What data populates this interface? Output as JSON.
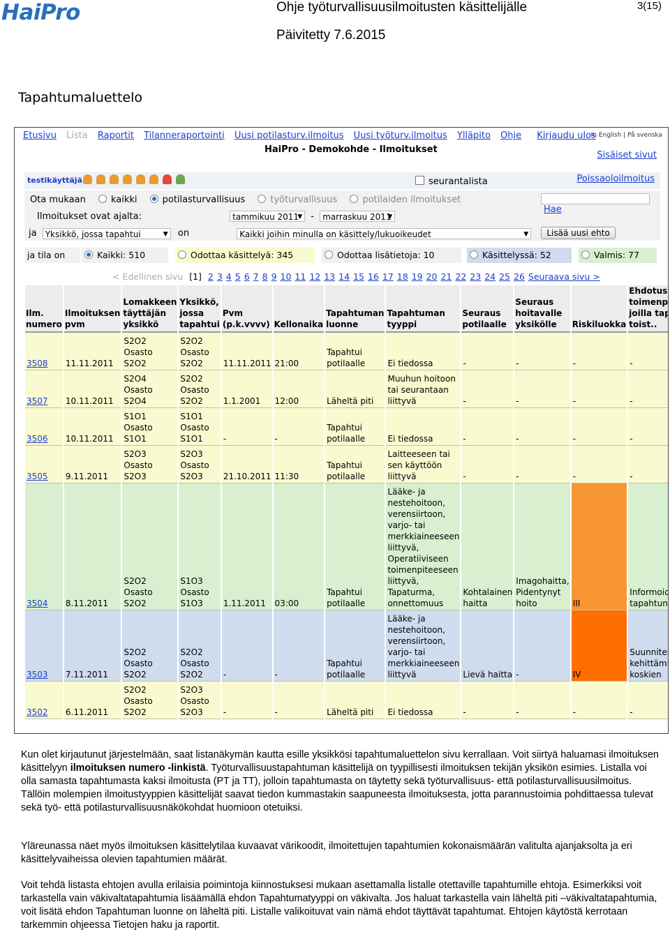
{
  "doc": {
    "logo": "HaiPro",
    "title": "Ohje työturvallisuusilmoitusten käsittelijälle",
    "updated": "Päivitetty 7.6.2015",
    "page": "3(15)",
    "section_heading": "Tapahtumaluettelo"
  },
  "app": {
    "nav": [
      "Etusivu",
      "Lista",
      "Raportit",
      "Tilanneraportointi",
      "Uusi potilasturv.ilmoitus",
      "Uusi työturv.ilmoitus",
      "Ylläpito",
      "Ohje",
      "Kirjaudu ulos"
    ],
    "nav_disabled": "Lista",
    "lang_links": "In English | På svenska",
    "title": "HaiPro - Demokohde - Ilmoitukset",
    "intranet_link": "Sisäiset sivut",
    "username": "testikäyttäjä",
    "follow_label": "seurantalista",
    "absence_link": "Poissaoloilmoitus",
    "filters": {
      "take_label": "Ota mukaan",
      "type_options": [
        "kaikki",
        "potilasturvallisuus",
        "työturvallisuus",
        "potilaiden ilmoitukset"
      ],
      "type_selected": "potilasturvallisuus",
      "period_label": "Ilmoitukset ovat ajalta:",
      "from": "tammikuu 2011",
      "dash": "-",
      "to": "marraskuu 2011",
      "and_label": "ja",
      "unit_select": "Yksikkö, jossa tapahtui",
      "on_label": "on",
      "scope_select": "Kaikki joihin minulla on käsittely/lukuoikeudet",
      "add_condition": "Lisää uusi ehto",
      "search_value": "",
      "search_link": "Hae"
    },
    "status": {
      "label": "ja tila on",
      "items": [
        {
          "text": "Kaikki: 510",
          "color": "#f0f0f0",
          "selected": true
        },
        {
          "text": "Odottaa käsittelyä: 345",
          "color": "#fafad0",
          "selected": false
        },
        {
          "text": "Odottaa lisätietoja: 10",
          "color": "#f0f0f0",
          "selected": false
        },
        {
          "text": "Käsittelyssä: 52",
          "color": "#cfdcee",
          "selected": false
        },
        {
          "text": "Valmis: 77",
          "color": "#d8f0d0",
          "selected": false
        }
      ]
    },
    "pager": {
      "prev": "< Edellinen sivu",
      "current": "[1]",
      "pages": [
        "2",
        "3",
        "4",
        "5",
        "6",
        "7",
        "8",
        "9",
        "10",
        "11",
        "12",
        "13",
        "14",
        "15",
        "16",
        "17",
        "18",
        "19",
        "20",
        "21",
        "22",
        "23",
        "24",
        "25",
        "26"
      ],
      "next": "Seuraava sivu >"
    },
    "table": {
      "headers": [
        "Ilm. numero",
        "Ilmoituksen pvm",
        "Lomakkeen täyttäjän yksikkö",
        "Yksikkö, jossa tapahtui",
        "Pvm (p.k.vvvv)",
        "Kellonaika",
        "Tapahtuman luonne",
        "Tapahtuman tyyppi",
        "Seuraus potilaalle",
        "Seuraus hoitavalle yksikölle",
        "Riskiluokka",
        "Ehdotus toimenpiteiksi, joilla tapahtuman toist.."
      ],
      "rows": [
        {
          "state": "y",
          "num": "3508",
          "date": "11.11.2011",
          "filler": "S2O2 Osasto S2O2",
          "unit": "S2O2 Osasto S2O2",
          "pvm": "11.11.2011",
          "time": "21:00",
          "nature": "Tapahtui potilaalle",
          "type": "Ei tiedossa",
          "patient": "-",
          "unit_cons": "-",
          "risk": "-",
          "risk_class": "",
          "proposal": "-"
        },
        {
          "state": "y",
          "num": "3507",
          "date": "10.11.2011",
          "filler": "S2O4 Osasto S2O4",
          "unit": "S2O2 Osasto S2O2",
          "pvm": "1.1.2001",
          "time": "12:00",
          "nature": "Läheltä piti",
          "type": "Muuhun hoitoon tai seurantaan liittyvä",
          "patient": "-",
          "unit_cons": "-",
          "risk": "-",
          "risk_class": "",
          "proposal": "-"
        },
        {
          "state": "y",
          "num": "3506",
          "date": "10.11.2011",
          "filler": "S1O1 Osasto S1O1",
          "unit": "S1O1 Osasto S1O1",
          "pvm": "-",
          "time": "-",
          "nature": "Tapahtui potilaalle",
          "type": "Ei tiedossa",
          "patient": "-",
          "unit_cons": "-",
          "risk": "-",
          "risk_class": "",
          "proposal": "-"
        },
        {
          "state": "y",
          "num": "3505",
          "date": "9.11.2011",
          "filler": "S2O3 Osasto S2O3",
          "unit": "S2O3 Osasto S2O3",
          "pvm": "21.10.2011",
          "time": "11:30",
          "nature": "Tapahtui potilaalle",
          "type": "Laitteeseen tai sen käyttöön liittyvä",
          "patient": "-",
          "unit_cons": "-",
          "risk": "-",
          "risk_class": "",
          "proposal": "-"
        },
        {
          "state": "g",
          "num": "3504",
          "date": "8.11.2011",
          "filler": "S2O2 Osasto S2O2",
          "unit": "S1O3 Osasto S1O3",
          "pvm": "1.11.2011",
          "time": "03:00",
          "nature": "Tapahtui potilaalle",
          "type": "Lääke- ja nestehoitoon, verensiirtoon, varjo- tai merkkiaineeseen liittyvä, Operatiiviseen toimenpiteeseen liittyvä, Tapaturma, onnettomuus",
          "patient": "Kohtalainen haitta",
          "unit_cons": "Imagohaitta, Pidentynyt hoito",
          "risk": "III",
          "risk_class": "risk3",
          "proposal": "Informoidaan tapahtuneesta"
        },
        {
          "state": "b",
          "num": "3503",
          "date": "7.11.2011",
          "filler": "S2O2 Osasto S2O2",
          "unit": "S2O2 Osasto S2O2",
          "pvm": "-",
          "time": "-",
          "nature": "Tapahtui potilaalle",
          "type": "Lääke- ja nestehoitoon, verensiirtoon, varjo- tai merkkiaineeseen liittyvä",
          "patient": "Lievä haitta",
          "unit_cons": "-",
          "risk": "IV",
          "risk_class": "risk4",
          "proposal": "Suunnitellaan kehittämistoimenpide koskien"
        },
        {
          "state": "y",
          "num": "3502",
          "date": "6.11.2011",
          "filler": "S2O2 Osasto S2O2",
          "unit": "S2O3 Osasto S2O3",
          "pvm": "-",
          "time": "-",
          "nature": "Läheltä piti",
          "type": "Ei tiedossa",
          "patient": "-",
          "unit_cons": "-",
          "risk": "-",
          "risk_class": "",
          "proposal": "-"
        }
      ]
    }
  },
  "body_text": {
    "p1_a": "Kun olet kirjautunut järjestelmään, saat listanäkymän kautta esille yksikkösi tapahtumaluettelon sivu kerrallaan. Voit siirtyä haluamasi ilmoituksen käsittelyyn ",
    "p1_bold": "ilmoituksen numero -linkistä",
    "p1_b": ". Työturvallisuustapahtuman käsittelijä on tyypillisesti ilmoituksen tekijän yksikön esimies.  Listalla voi olla samasta tapahtumasta kaksi ilmoitusta (PT ja TT), jolloin tapahtumasta on täytetty sekä työturvallisuus- että potilasturvallisuusilmoitus. Tällöin molempien ilmoitustyyppien käsittelijät saavat tiedon kummastakin saapuneesta ilmoituksesta, jotta parannustoimia pohdittaessa tulevat sekä työ- että potilasturvallisuusnäkökohdat huomioon otetuiksi.",
    "p2": "Yläreunassa näet myös ilmoituksen käsittelytilaa kuvaavat värikoodit, ilmoitettujen tapahtumien kokonaismäärän valitulta ajanjaksolta ja eri käsittelyvaiheissa olevien tapahtumien määrät.",
    "p3": "Voit tehdä listasta ehtojen avulla erilaisia poimintoja kiinnostuksesi mukaan asettamalla listalle otettaville tapahtumille ehtoja. Esimerkiksi voit tarkastella vain väkivaltatapahtumia lisäämällä ehdon Tapahtumatyyppi on väkivalta. Jos haluat tarkastella vain läheltä piti –väkivaltatapahtumia, voit lisätä ehdon Tapahtuman luonne on läheltä piti. Listalle valikoituvat vain nämä ehdot täyttävät tapahtumat. Ehtojen käytöstä kerrotaan tarkemmin ohjeessa Tietojen haku ja raportit."
  }
}
